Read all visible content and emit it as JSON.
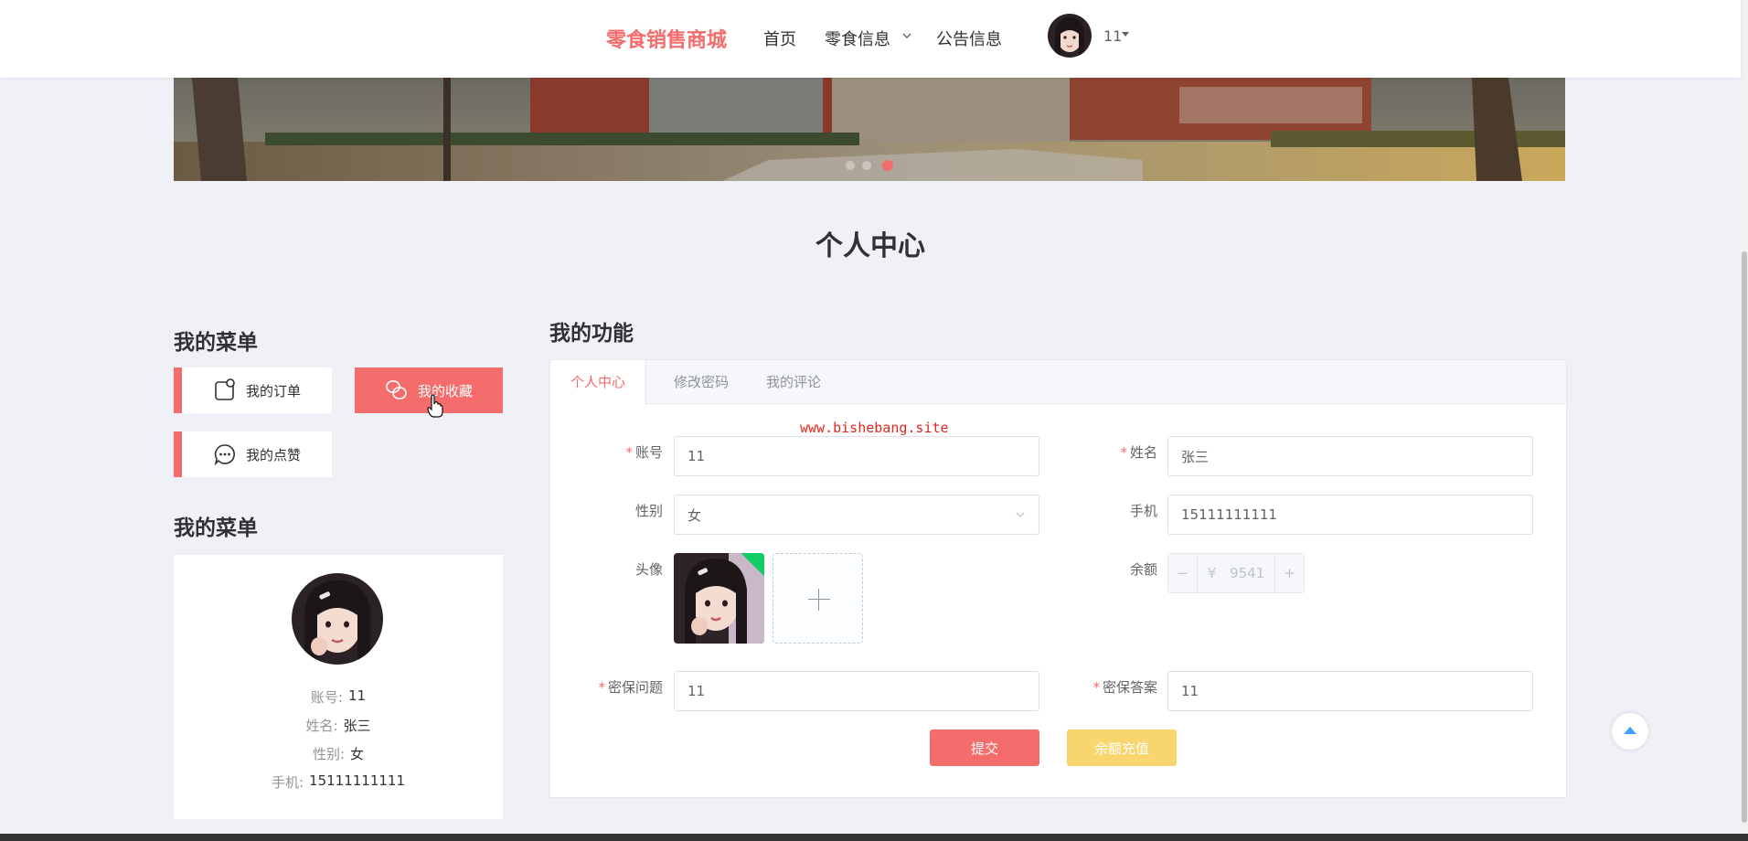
{
  "nav": {
    "brand": "零食销售商城",
    "links": [
      "首页",
      "零食信息",
      "公告信息"
    ],
    "username": "11",
    "icons": {
      "avatar": "user-avatar",
      "dropdown": "chevron-down-icon",
      "caret": "caret-down-icon"
    }
  },
  "banner": {
    "slides": 3,
    "active_slide": 3
  },
  "page_title": "个人中心",
  "left": {
    "menu_title": "我的菜单",
    "menu_items": [
      {
        "label": "我的订单",
        "icon": "order-icon"
      },
      {
        "label": "我的收藏",
        "icon": "favorite-icon"
      },
      {
        "label": "我的点赞",
        "icon": "chat-bubble-icon"
      }
    ],
    "profile_title": "我的菜单",
    "profile": {
      "fields": [
        {
          "key": "账号:",
          "value": "11"
        },
        {
          "key": "姓名:",
          "value": "张三"
        },
        {
          "key": "性别:",
          "value": "女"
        },
        {
          "key": "手机:",
          "value": "15111111111"
        }
      ]
    }
  },
  "right": {
    "title": "我的功能",
    "tabs": [
      "个人中心",
      "修改密码",
      "我的评论"
    ],
    "active_tab": "个人中心",
    "watermark": "www.bishebang.site",
    "form": {
      "account_label": "账号",
      "account_value": "11",
      "name_label": "姓名",
      "name_value": "张三",
      "gender_label": "性别",
      "gender_value": "女",
      "phone_label": "手机",
      "phone_value": "15111111111",
      "avatar_label": "头像",
      "balance_label": "余额",
      "balance_prefix": "¥",
      "balance_value": "9541",
      "question_label": "密保问题",
      "question_value": "11",
      "answer_label": "密保答案",
      "answer_value": "11"
    },
    "buttons": {
      "submit": "提交",
      "recharge": "余额充值"
    }
  },
  "colors": {
    "accent": "#f56c6c",
    "warning": "#f8d56d",
    "background": "#f0f0f7",
    "link_blue": "#409eff"
  }
}
